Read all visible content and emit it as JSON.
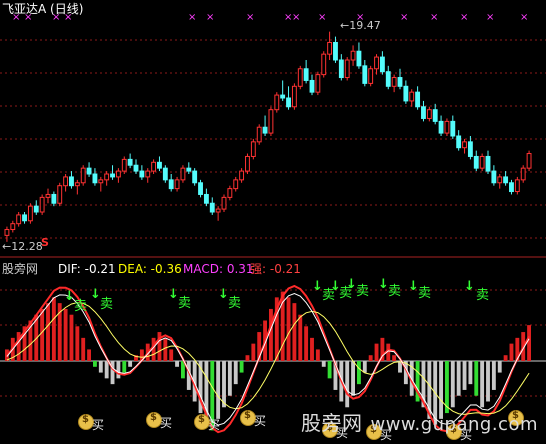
{
  "chart": {
    "title": "飞亚达A (日线)",
    "high_label": "19.47",
    "low_label": "12.28",
    "s_marker": "S"
  },
  "indicator": {
    "name": "股旁网",
    "dif": "DIF: -0.21",
    "dea": "DEA: -0.36",
    "macd": "MACD: 0.31",
    "qiang": "强: -0.21"
  },
  "signals": {
    "sell_label": "卖",
    "buy_label": "买",
    "down_arrow": "↓"
  },
  "watermark": {
    "name": "股旁网",
    "url": "www.gupang.com"
  },
  "colors": {
    "up": "#ff3232",
    "down": "#54fcfc",
    "macd_pos": "#e02020",
    "macd_neg_light": "#c8c8c8",
    "macd_neg_green": "#33dd33",
    "grid": "#8b1a1a",
    "x_marker": "#ff40ff"
  },
  "chart_data": {
    "type": "candlestick",
    "title": "飞亚达A (日线)",
    "annotations": [
      "19.47",
      "12.28"
    ],
    "ohlc": [
      [
        12.5,
        12.8,
        12.28,
        12.7
      ],
      [
        12.7,
        13.0,
        12.6,
        12.9
      ],
      [
        12.9,
        13.3,
        12.8,
        13.2
      ],
      [
        13.2,
        13.3,
        12.9,
        13.0
      ],
      [
        13.0,
        13.6,
        12.9,
        13.5
      ],
      [
        13.5,
        13.7,
        13.2,
        13.3
      ],
      [
        13.3,
        13.9,
        13.2,
        13.8
      ],
      [
        13.8,
        14.1,
        13.6,
        13.9
      ],
      [
        13.9,
        14.0,
        13.5,
        13.6
      ],
      [
        13.6,
        14.3,
        13.5,
        14.2
      ],
      [
        14.2,
        14.6,
        14.0,
        14.5
      ],
      [
        14.5,
        14.7,
        14.1,
        14.2
      ],
      [
        14.2,
        14.4,
        13.9,
        14.3
      ],
      [
        14.3,
        14.9,
        14.2,
        14.8
      ],
      [
        14.8,
        15.0,
        14.5,
        14.6
      ],
      [
        14.6,
        14.8,
        14.2,
        14.3
      ],
      [
        14.3,
        14.5,
        14.0,
        14.4
      ],
      [
        14.4,
        14.7,
        14.2,
        14.6
      ],
      [
        14.6,
        14.9,
        14.4,
        14.5
      ],
      [
        14.5,
        14.8,
        14.3,
        14.7
      ],
      [
        14.7,
        15.2,
        14.6,
        15.1
      ],
      [
        15.1,
        15.3,
        14.8,
        14.9
      ],
      [
        14.9,
        15.1,
        14.6,
        14.7
      ],
      [
        14.7,
        14.9,
        14.4,
        14.5
      ],
      [
        14.5,
        14.8,
        14.3,
        14.7
      ],
      [
        14.7,
        15.1,
        14.6,
        15.0
      ],
      [
        15.0,
        15.2,
        14.7,
        14.8
      ],
      [
        14.8,
        14.9,
        14.3,
        14.4
      ],
      [
        14.4,
        14.6,
        14.0,
        14.1
      ],
      [
        14.1,
        14.5,
        14.0,
        14.4
      ],
      [
        14.4,
        14.9,
        14.3,
        14.8
      ],
      [
        14.8,
        15.0,
        14.6,
        14.7
      ],
      [
        14.7,
        14.8,
        14.2,
        14.3
      ],
      [
        14.3,
        14.4,
        13.8,
        13.9
      ],
      [
        13.9,
        14.1,
        13.5,
        13.6
      ],
      [
        13.6,
        13.8,
        13.2,
        13.3
      ],
      [
        13.3,
        13.5,
        13.0,
        13.4
      ],
      [
        13.4,
        13.9,
        13.3,
        13.8
      ],
      [
        13.8,
        14.2,
        13.7,
        14.1
      ],
      [
        14.1,
        14.5,
        14.0,
        14.4
      ],
      [
        14.4,
        14.8,
        14.3,
        14.7
      ],
      [
        14.7,
        15.3,
        14.6,
        15.2
      ],
      [
        15.2,
        15.8,
        15.1,
        15.7
      ],
      [
        15.7,
        16.3,
        15.6,
        16.2
      ],
      [
        16.2,
        16.6,
        15.9,
        16.0
      ],
      [
        16.0,
        16.9,
        15.9,
        16.8
      ],
      [
        16.8,
        17.4,
        16.7,
        17.3
      ],
      [
        17.3,
        17.8,
        17.1,
        17.2
      ],
      [
        17.2,
        17.6,
        16.8,
        16.9
      ],
      [
        16.9,
        17.7,
        16.8,
        17.6
      ],
      [
        17.6,
        18.3,
        17.5,
        18.2
      ],
      [
        18.2,
        18.5,
        17.7,
        17.8
      ],
      [
        17.8,
        18.0,
        17.3,
        17.4
      ],
      [
        17.4,
        18.1,
        17.3,
        18.0
      ],
      [
        18.0,
        18.8,
        17.9,
        18.7
      ],
      [
        18.7,
        19.47,
        18.5,
        19.1
      ],
      [
        19.1,
        19.3,
        18.4,
        18.5
      ],
      [
        18.5,
        18.7,
        17.8,
        17.9
      ],
      [
        17.9,
        18.6,
        17.8,
        18.5
      ],
      [
        18.5,
        19.0,
        18.3,
        18.8
      ],
      [
        18.8,
        19.1,
        18.2,
        18.3
      ],
      [
        18.3,
        18.5,
        17.6,
        17.7
      ],
      [
        17.7,
        18.3,
        17.6,
        18.2
      ],
      [
        18.2,
        18.7,
        18.0,
        18.6
      ],
      [
        18.6,
        18.8,
        18.0,
        18.1
      ],
      [
        18.1,
        18.3,
        17.5,
        17.6
      ],
      [
        17.6,
        18.0,
        17.4,
        17.9
      ],
      [
        17.9,
        18.2,
        17.5,
        17.6
      ],
      [
        17.6,
        17.8,
        17.0,
        17.1
      ],
      [
        17.1,
        17.5,
        16.9,
        17.4
      ],
      [
        17.4,
        17.6,
        16.8,
        16.9
      ],
      [
        16.9,
        17.1,
        16.4,
        16.5
      ],
      [
        16.5,
        16.9,
        16.4,
        16.8
      ],
      [
        16.8,
        17.0,
        16.3,
        16.4
      ],
      [
        16.4,
        16.6,
        15.9,
        16.0
      ],
      [
        16.0,
        16.5,
        15.9,
        16.4
      ],
      [
        16.4,
        16.6,
        15.8,
        15.9
      ],
      [
        15.9,
        16.1,
        15.4,
        15.5
      ],
      [
        15.5,
        15.8,
        15.3,
        15.7
      ],
      [
        15.7,
        15.9,
        15.1,
        15.2
      ],
      [
        15.2,
        15.4,
        14.7,
        14.8
      ],
      [
        14.8,
        15.3,
        14.7,
        15.2
      ],
      [
        15.2,
        15.4,
        14.6,
        14.7
      ],
      [
        14.7,
        14.9,
        14.2,
        14.3
      ],
      [
        14.3,
        14.6,
        14.1,
        14.5
      ],
      [
        14.5,
        14.7,
        14.2,
        14.3
      ],
      [
        14.3,
        14.4,
        13.9,
        14.0
      ],
      [
        14.0,
        14.5,
        13.9,
        14.4
      ],
      [
        14.4,
        14.9,
        14.3,
        14.8
      ],
      [
        14.8,
        15.4,
        14.7,
        15.3
      ]
    ],
    "macd_values": [
      0.1,
      0.2,
      0.25,
      0.3,
      0.35,
      0.4,
      0.45,
      0.5,
      0.55,
      0.5,
      0.45,
      0.4,
      0.3,
      0.2,
      0.1,
      -0.05,
      -0.1,
      -0.15,
      -0.2,
      -0.15,
      -0.1,
      -0.05,
      0.05,
      0.1,
      0.15,
      0.2,
      0.25,
      0.2,
      0.1,
      -0.05,
      -0.15,
      -0.25,
      -0.35,
      -0.45,
      -0.55,
      -0.6,
      -0.5,
      -0.4,
      -0.3,
      -0.2,
      -0.1,
      0.05,
      0.15,
      0.25,
      0.35,
      0.45,
      0.55,
      0.6,
      0.55,
      0.5,
      0.4,
      0.3,
      0.2,
      0.1,
      -0.05,
      -0.15,
      -0.25,
      -0.35,
      -0.4,
      -0.3,
      -0.2,
      -0.1,
      0.05,
      0.15,
      0.2,
      0.15,
      0.05,
      -0.1,
      -0.2,
      -0.3,
      -0.35,
      -0.4,
      -0.5,
      -0.55,
      -0.5,
      -0.45,
      -0.4,
      -0.3,
      -0.25,
      -0.2,
      -0.3,
      -0.4,
      -0.35,
      -0.25,
      -0.1,
      0.05,
      0.15,
      0.2,
      0.25,
      0.31
    ]
  }
}
